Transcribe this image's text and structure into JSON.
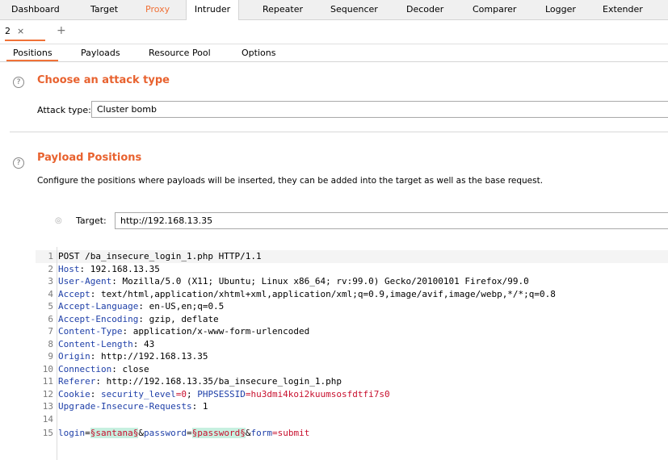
{
  "top_tabs": [
    "Dashboard",
    "Target",
    "Proxy",
    "Intruder",
    "Repeater",
    "Sequencer",
    "Decoder",
    "Comparer",
    "Logger",
    "Extender"
  ],
  "attack_tab": {
    "label": "2",
    "close": "×",
    "add": "+"
  },
  "inner_tabs": [
    "Positions",
    "Payloads",
    "Resource Pool",
    "Options"
  ],
  "attack_type_section": {
    "help": "?",
    "heading": "Choose an attack type",
    "label": "Attack type:",
    "value": "Cluster bomb"
  },
  "payload_positions": {
    "help": "?",
    "heading": "Payload Positions",
    "description": "Configure the positions where payloads will be inserted, they can be added into the target as well as the base request.",
    "target_label": "Target:",
    "target_value": "http://192.168.13.35"
  },
  "request_lines": [
    {
      "n": "1",
      "text": "POST /ba_insecure_login_1.php HTTP/1.1"
    },
    {
      "n": "2",
      "key": "Host",
      "value": " 192.168.13.35"
    },
    {
      "n": "3",
      "key": "User-Agent",
      "value": " Mozilla/5.0 (X11; Ubuntu; Linux x86_64; rv:99.0) Gecko/20100101 Firefox/99.0"
    },
    {
      "n": "4",
      "key": "Accept",
      "value": " text/html,application/xhtml+xml,application/xml;q=0.9,image/avif,image/webp,*/*;q=0.8"
    },
    {
      "n": "5",
      "key": "Accept-Language",
      "value": " en-US,en;q=0.5"
    },
    {
      "n": "6",
      "key": "Accept-Encoding",
      "value": " gzip, deflate"
    },
    {
      "n": "7",
      "key": "Content-Type",
      "value": " application/x-www-form-urlencoded"
    },
    {
      "n": "8",
      "key": "Content-Length",
      "value": " 43"
    },
    {
      "n": "9",
      "key": "Origin",
      "value": " http://192.168.13.35"
    },
    {
      "n": "10",
      "key": "Connection",
      "value": " close"
    },
    {
      "n": "11",
      "key": "Referer",
      "value": " http://192.168.13.35/ba_insecure_login_1.php"
    },
    {
      "n": "12",
      "key": "Cookie",
      "cookie_k1": " security_level",
      "cookie_v1": "=0",
      "cookie_sep": "; ",
      "cookie_k2": "PHPSESSID",
      "cookie_v2": "=hu3dmi4koi2kuumsosfdtfi7s0"
    },
    {
      "n": "13",
      "key": "Upgrade-Insecure-Requests",
      "value": " 1"
    },
    {
      "n": "14",
      "text": ""
    },
    {
      "n": "15",
      "body_k1": "login",
      "eq1": "=",
      "payload1": "§santana§",
      "sep1": "&",
      "body_k2": "password",
      "eq2": "=",
      "payload2": "§password§",
      "sep2": "&",
      "body_k3": "form",
      "body_v3": "=submit"
    }
  ]
}
